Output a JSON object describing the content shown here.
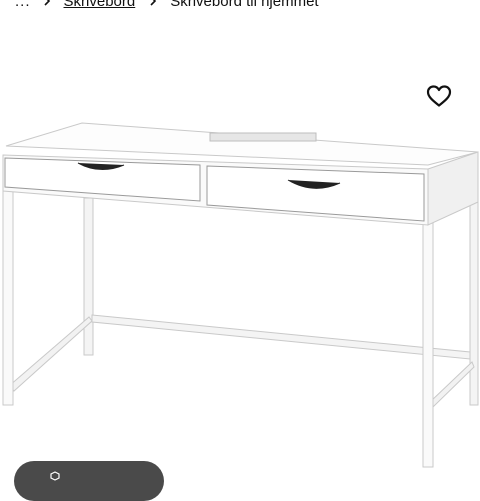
{
  "breadcrumb": {
    "ellipsis": "...",
    "items": [
      {
        "label": "Skrivebord",
        "link": true
      },
      {
        "label": "Skrivebord til hjemmet",
        "link": false
      }
    ]
  },
  "icons": {
    "separator": "chevron-right-icon",
    "favourite": "heart-outline-icon",
    "pill": "cube-icon"
  },
  "colors": {
    "text": "#111111",
    "pill": "#4a4a4a",
    "desk": "#ffffff",
    "desk_edge": "#cfcfcf"
  }
}
